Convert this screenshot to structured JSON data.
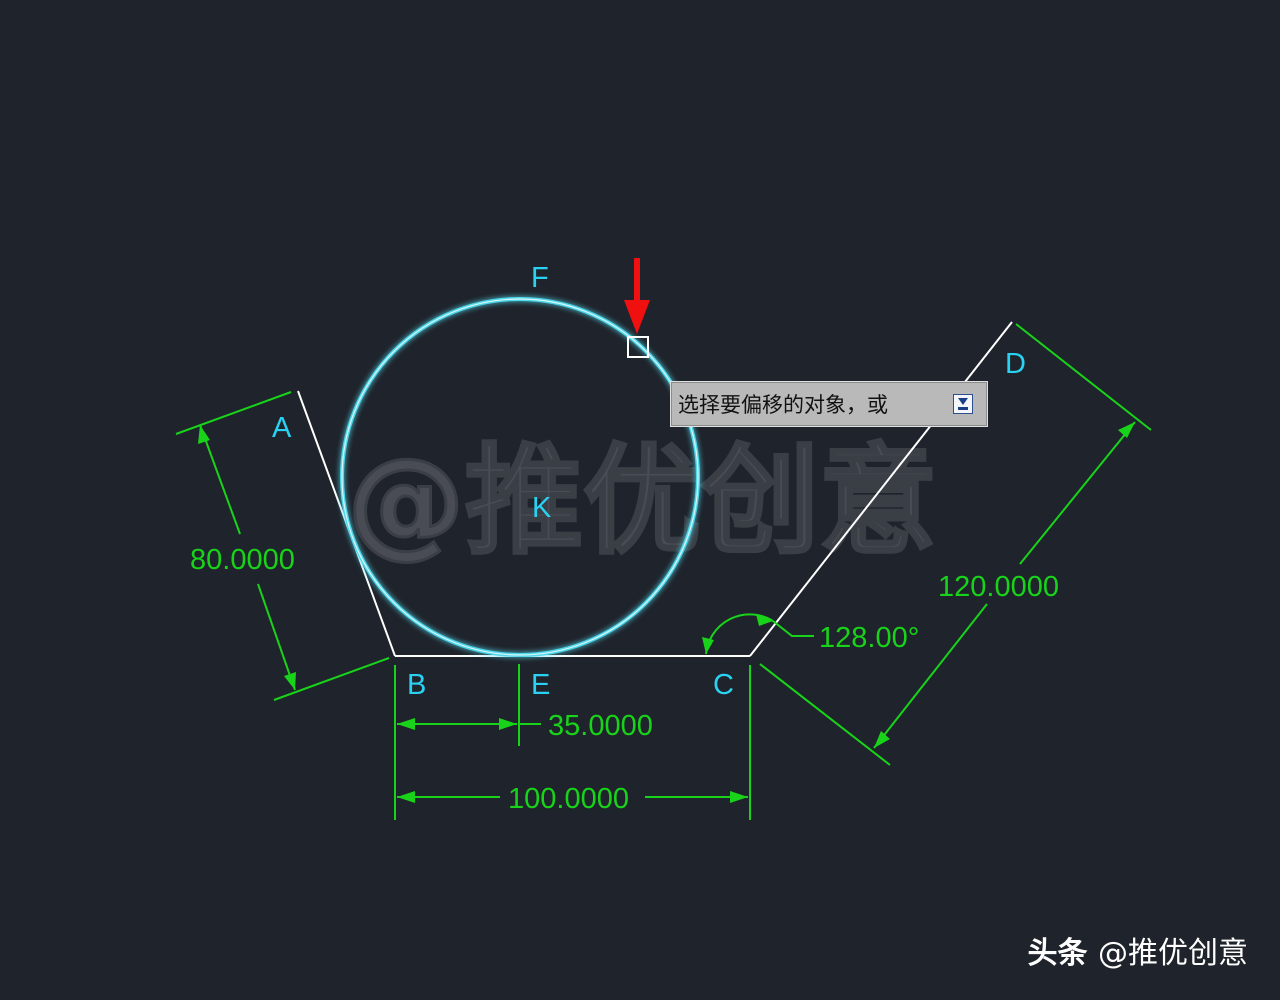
{
  "colors": {
    "background": "#1f232b",
    "dimension": "#19d31a",
    "label": "#29d2f2",
    "circle": "#4fd7ea",
    "geometry": "#ffffff",
    "marker_arrow": "#f01010",
    "watermark": "#6b6f76"
  },
  "points": {
    "a": "A",
    "b": "B",
    "c": "C",
    "d": "D",
    "e": "E",
    "f": "F",
    "k": "K"
  },
  "dimensions": {
    "ab_length": "80.0000",
    "be_length": "35.0000",
    "bc_length": "100.0000",
    "cd_length": "120.0000",
    "angle_c": "128.00°"
  },
  "watermark": "@推优创意",
  "tooltip": {
    "prompt": "选择要偏移的对象，或",
    "icon": "expand-down-icon"
  },
  "footer": {
    "brand": "头条",
    "handle": "@推优创意"
  }
}
